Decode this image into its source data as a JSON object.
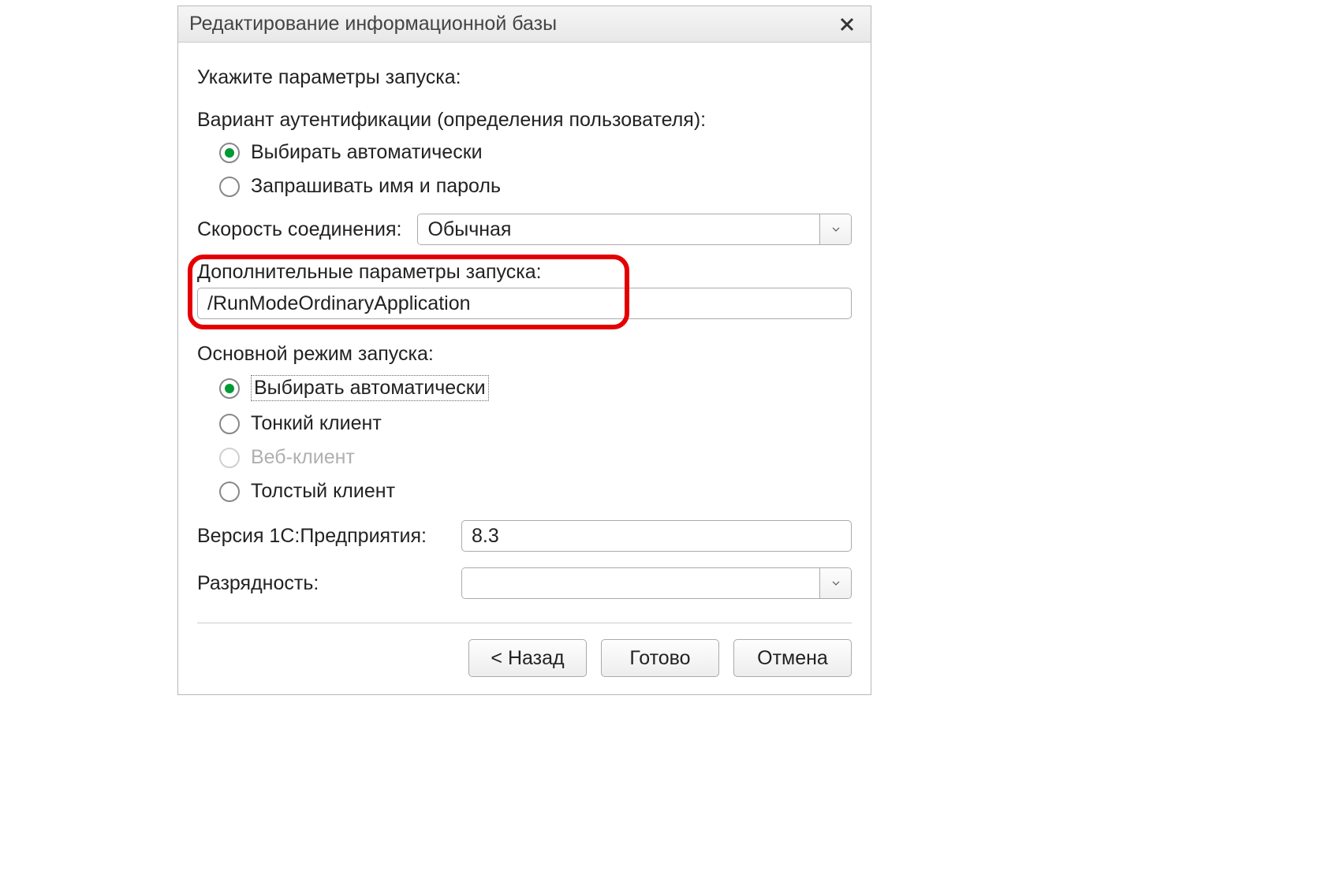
{
  "titlebar": {
    "title": "Редактирование информационной базы"
  },
  "main": {
    "heading": "Укажите параметры запуска:",
    "auth": {
      "label": "Вариант аутентификации (определения пользователя):",
      "options": [
        {
          "label": "Выбирать автоматически",
          "selected": true
        },
        {
          "label": "Запрашивать имя и пароль",
          "selected": false
        }
      ]
    },
    "speed": {
      "label": "Скорость соединения:",
      "value": "Обычная"
    },
    "additional_params": {
      "label": "Дополнительные параметры запуска:",
      "value": "/RunModeOrdinaryApplication"
    },
    "launch_mode": {
      "label": "Основной режим запуска:",
      "options": [
        {
          "label": "Выбирать автоматически",
          "selected": true,
          "disabled": false,
          "focused": true
        },
        {
          "label": "Тонкий клиент",
          "selected": false,
          "disabled": false
        },
        {
          "label": "Веб-клиент",
          "selected": false,
          "disabled": true
        },
        {
          "label": "Толстый клиент",
          "selected": false,
          "disabled": false
        }
      ]
    },
    "version": {
      "label": "Версия 1С:Предприятия:",
      "value": "8.3"
    },
    "arch": {
      "label": "Разрядность:",
      "value": ""
    }
  },
  "buttons": {
    "back": "< Назад",
    "ready": "Готово",
    "cancel": "Отмена"
  }
}
